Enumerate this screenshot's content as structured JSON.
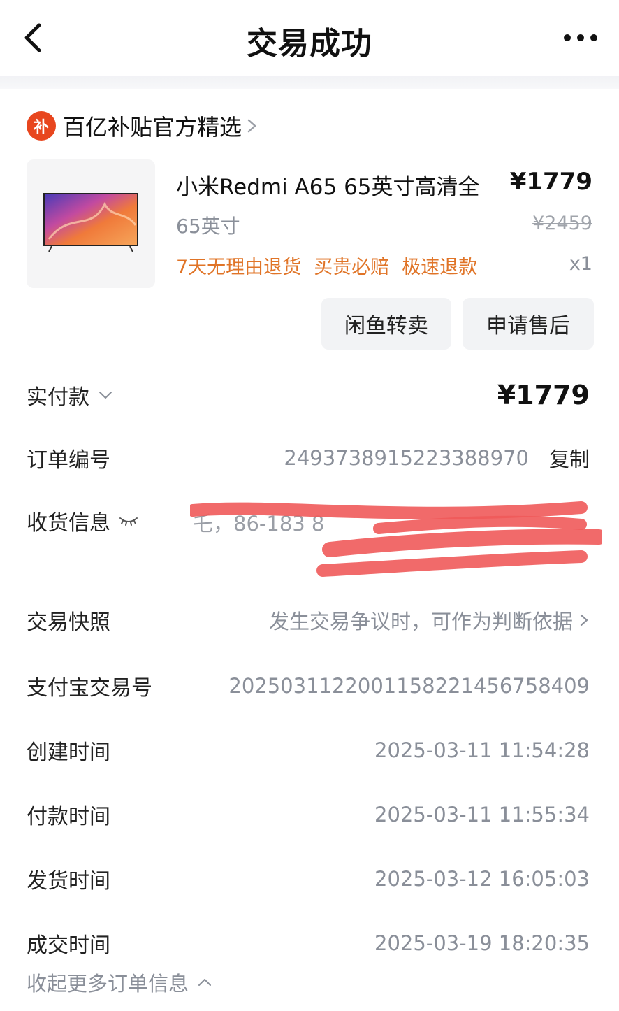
{
  "navbar": {
    "title": "交易成功",
    "back_icon": "chevron-left-icon",
    "more_icon": "more-dots-icon"
  },
  "store": {
    "badge_text": "补",
    "name": "百亿补贴官方精选",
    "badge_color": "#e8461e"
  },
  "product": {
    "title": "小米Redmi A65 65英寸高清全",
    "price": "¥1779",
    "spec": "65英寸",
    "original_price": "¥2459",
    "tags": [
      "7天无理由退货",
      "买贵必赔",
      "极速退款"
    ],
    "quantity": "x1",
    "tag_color": "#e07427"
  },
  "actions": {
    "resell_label": "闲鱼转卖",
    "after_sales_label": "申请售后"
  },
  "order": {
    "paid_label": "实付款",
    "paid_value": "¥1779",
    "order_no_label": "订单编号",
    "order_no_value": "2493738915223388970",
    "copy_label": "复制",
    "address_label": "收货信息",
    "address_visible": "乇，86-183      8",
    "snapshot_label": "交易快照",
    "snapshot_value": "发生交易争议时，可作为判断依据",
    "alipay_label": "支付宝交易号",
    "alipay_value": "2025031122001158221456758409",
    "created_label": "创建时间",
    "created_value": "2025-03-11 11:54:28",
    "paid_time_label": "付款时间",
    "paid_time_value": "2025-03-11 11:55:34",
    "shipped_label": "发货时间",
    "shipped_value": "2025-03-12 16:05:03",
    "completed_label": "成交时间",
    "completed_value": "2025-03-19 18:20:35",
    "collapse_label": "收起更多订单信息"
  }
}
